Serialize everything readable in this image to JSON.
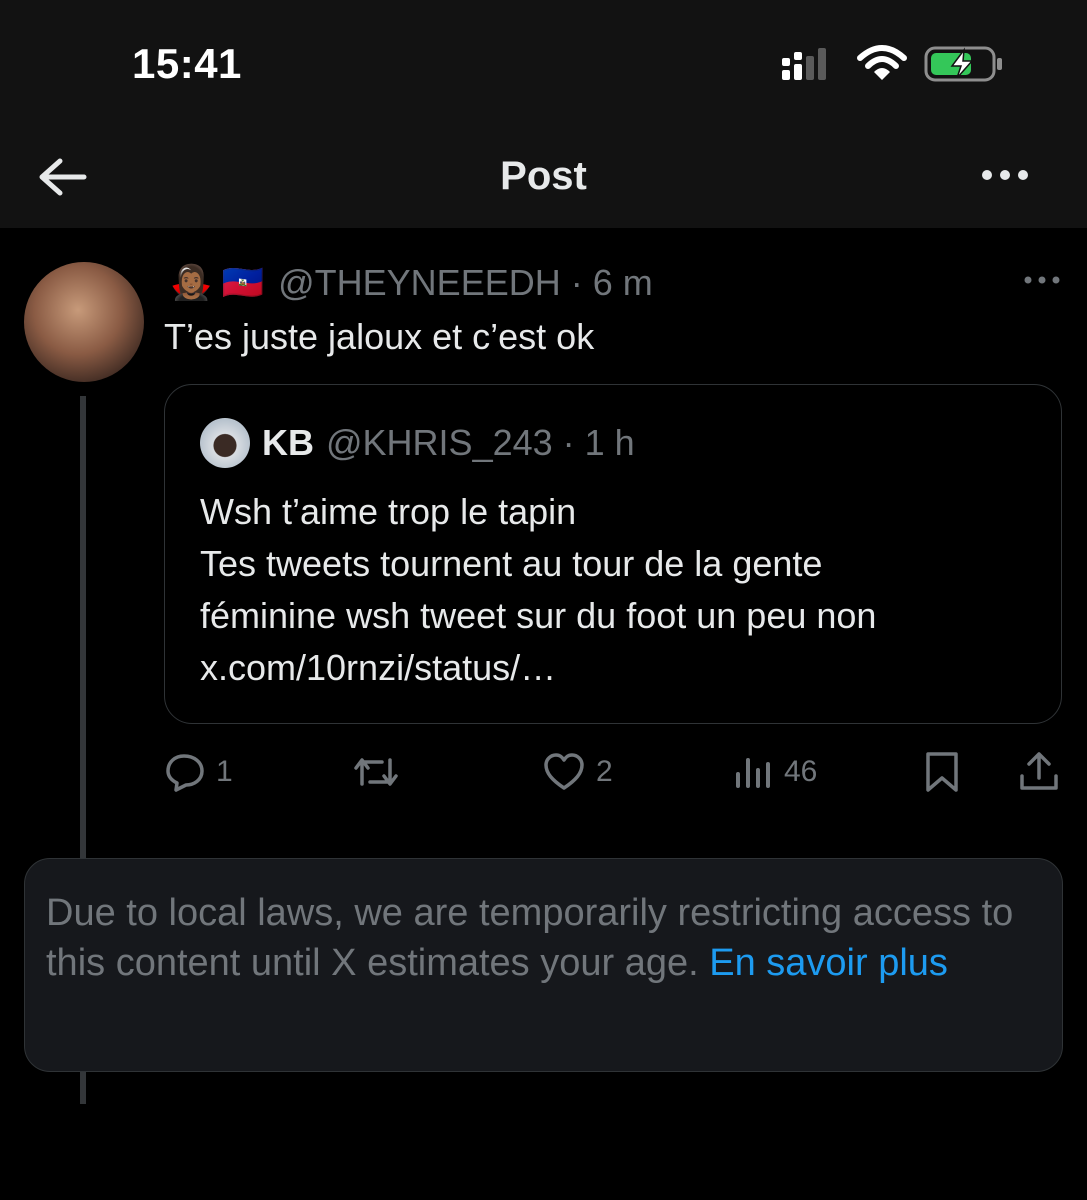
{
  "status_bar": {
    "time": "15:41"
  },
  "header": {
    "title": "Post"
  },
  "post": {
    "handle": "@THEYNEEEDH",
    "time": "6 m",
    "emojis": "🧛🏾‍♀️ 🇭🇹",
    "text": "T’es juste jaloux et c’est ok",
    "quote": {
      "name": "KB",
      "handle": "@KHRIS_243",
      "time": "1 h",
      "lines": [
        "Wsh t’aime trop le tapin",
        "Tes tweets tournent au tour de la gente",
        "féminine wsh tweet sur du foot un peu non",
        "x.com/10rnzi/status/…"
      ]
    },
    "actions": {
      "replies": "1",
      "reposts": "",
      "likes": "2",
      "views": "46"
    }
  },
  "notice": {
    "text": "Due to local laws, we are temporarily restricting access to this content until X estimates your age.",
    "link": "En savoir plus"
  },
  "colors": {
    "background": "#000000",
    "header": "#121212",
    "muted": "#71767b",
    "text": "#e7e9ea",
    "link": "#1d9bf0",
    "battery": "#34c759"
  }
}
